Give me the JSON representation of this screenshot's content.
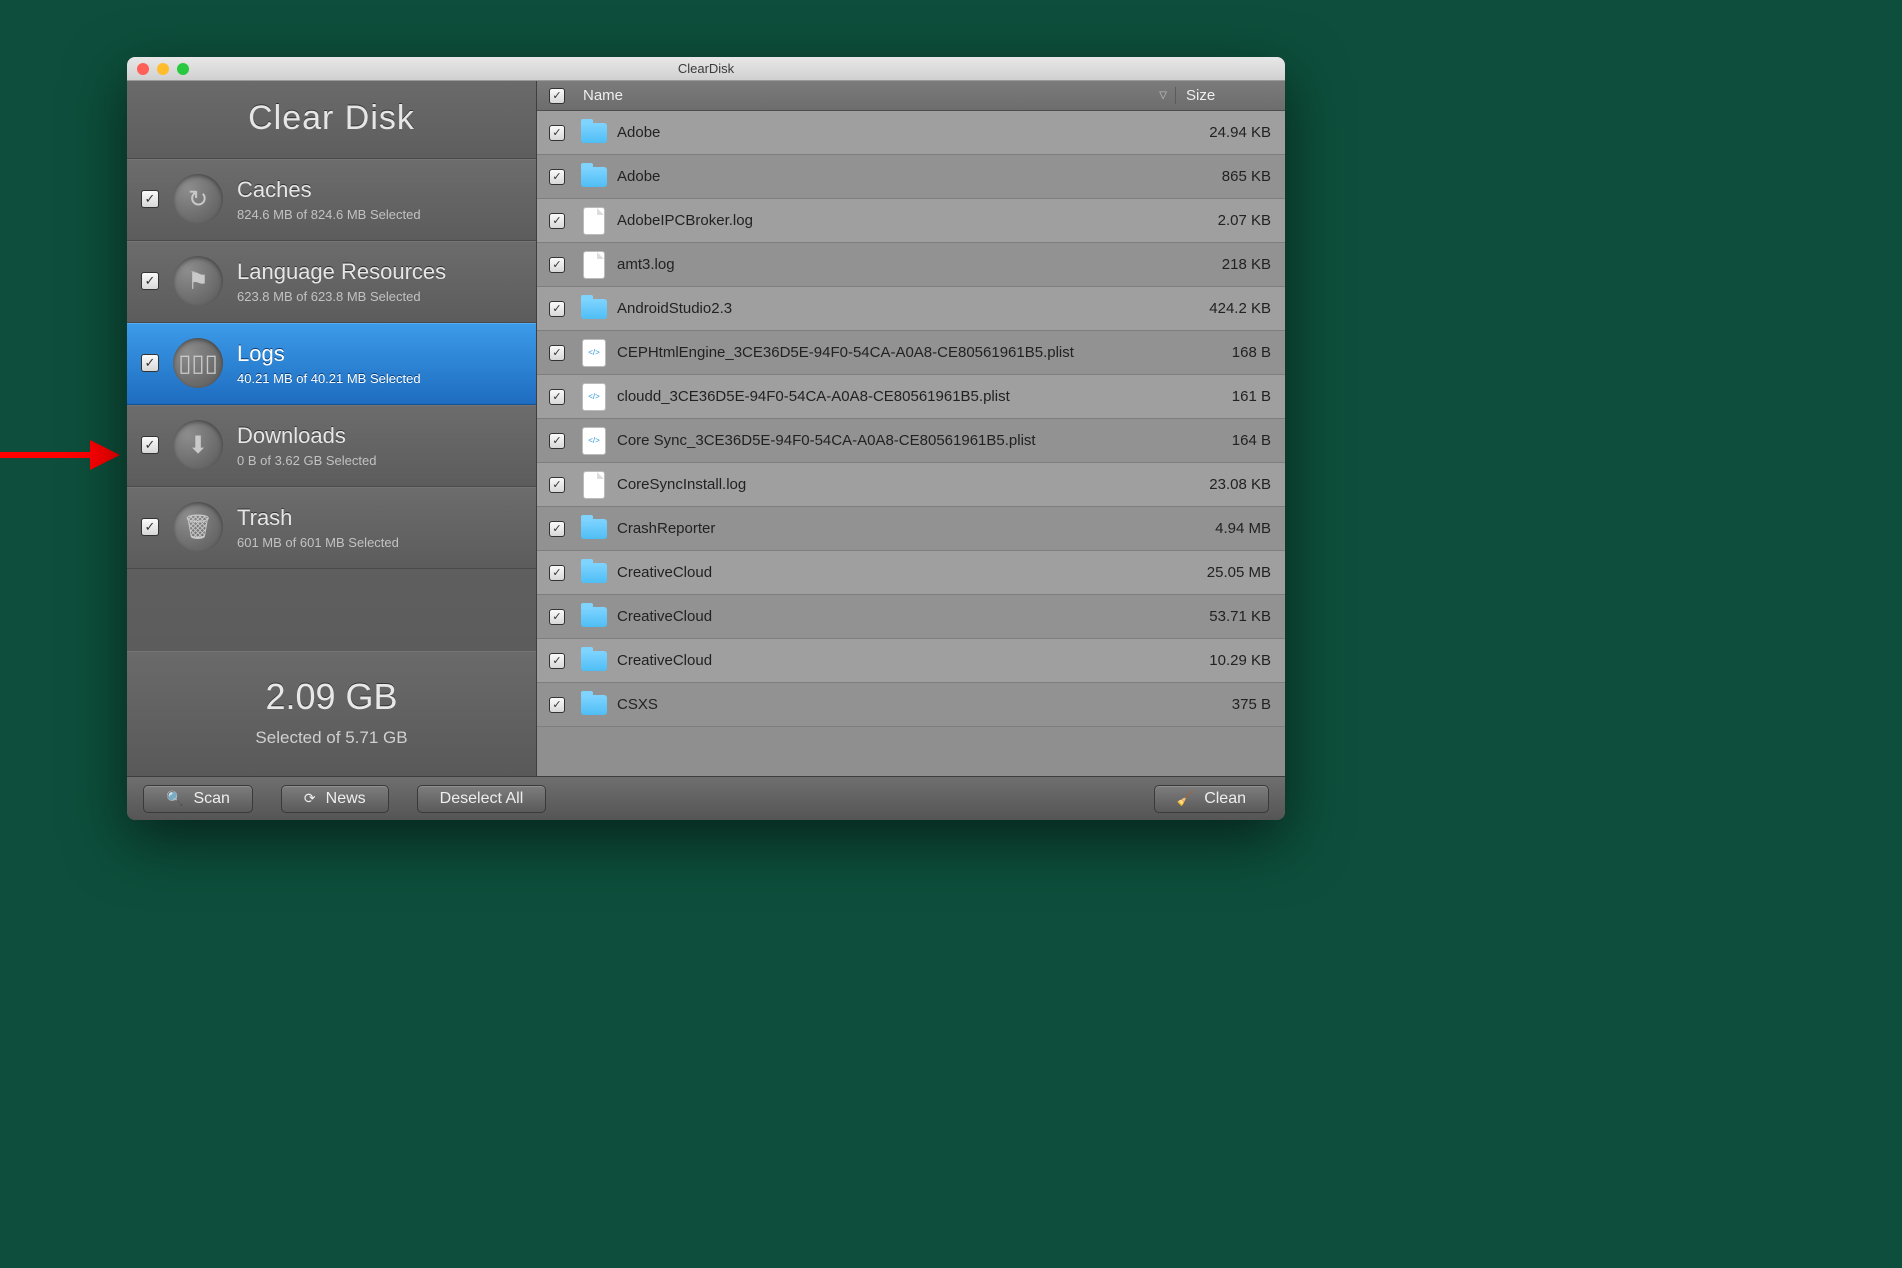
{
  "window_title": "ClearDisk",
  "brand": "Clear Disk",
  "categories": [
    {
      "name": "Caches",
      "sub": "824.6 MB of 824.6 MB Selected",
      "icon": "↻"
    },
    {
      "name": "Language Resources",
      "sub": "623.8 MB of 623.8 MB Selected",
      "icon": "⚑"
    },
    {
      "name": "Logs",
      "sub": "40.21 MB of 40.21 MB Selected",
      "icon": "▯▯▯",
      "selected": true
    },
    {
      "name": "Downloads",
      "sub": "0 B of 3.62 GB Selected",
      "icon": "⬇"
    },
    {
      "name": "Trash",
      "sub": "601 MB of 601 MB Selected",
      "icon": "🗑"
    }
  ],
  "summary": {
    "big": "2.09 GB",
    "sub": "Selected of 5.71 GB"
  },
  "columns": {
    "name": "Name",
    "size": "Size"
  },
  "buttons": {
    "scan": "Scan",
    "news": "News",
    "deselect": "Deselect All",
    "clean": "Clean"
  },
  "files": [
    {
      "name": "Adobe",
      "size": "24.94 KB",
      "type": "folder"
    },
    {
      "name": "Adobe",
      "size": "865 KB",
      "type": "folder"
    },
    {
      "name": "AdobeIPCBroker.log",
      "size": "2.07 KB",
      "type": "doc"
    },
    {
      "name": "amt3.log",
      "size": "218 KB",
      "type": "doc"
    },
    {
      "name": "AndroidStudio2.3",
      "size": "424.2 KB",
      "type": "folder"
    },
    {
      "name": "CEPHtmlEngine_3CE36D5E-94F0-54CA-A0A8-CE80561961B5.plist",
      "size": "168 B",
      "type": "plist"
    },
    {
      "name": "cloudd_3CE36D5E-94F0-54CA-A0A8-CE80561961B5.plist",
      "size": "161 B",
      "type": "plist"
    },
    {
      "name": "Core Sync_3CE36D5E-94F0-54CA-A0A8-CE80561961B5.plist",
      "size": "164 B",
      "type": "plist"
    },
    {
      "name": "CoreSyncInstall.log",
      "size": "23.08 KB",
      "type": "doc"
    },
    {
      "name": "CrashReporter",
      "size": "4.94 MB",
      "type": "folder"
    },
    {
      "name": "CreativeCloud",
      "size": "25.05 MB",
      "type": "folder"
    },
    {
      "name": "CreativeCloud",
      "size": "53.71 KB",
      "type": "folder"
    },
    {
      "name": "CreativeCloud",
      "size": "10.29 KB",
      "type": "folder"
    },
    {
      "name": "CSXS",
      "size": "375 B",
      "type": "folder"
    }
  ]
}
